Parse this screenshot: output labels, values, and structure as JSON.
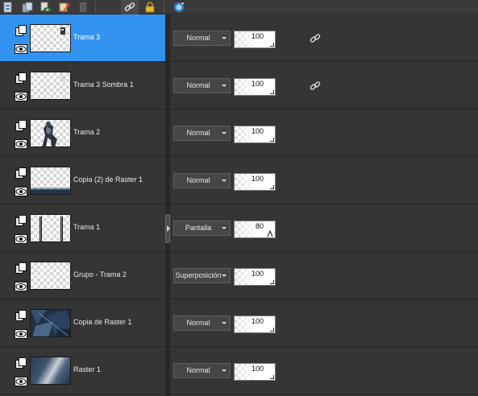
{
  "toolbar": {
    "icons": [
      "new-layer-icon",
      "new-group-icon",
      "visibility-toggle-icon",
      "delete-layer-icon",
      "mask-icon",
      "link-icon",
      "lock-icon",
      "refresh-icon"
    ]
  },
  "colors": {
    "panel_bg": "#353535",
    "selected_row": "#3393f0",
    "divider": "#262626"
  },
  "layers": [
    {
      "name": "Trama 3",
      "blend_mode": "Normal",
      "opacity": "100",
      "linked": true,
      "selected": true
    },
    {
      "name": "Trama 3 Sombra 1",
      "blend_mode": "Normal",
      "opacity": "100",
      "linked": true,
      "selected": false
    },
    {
      "name": "Trama 2",
      "blend_mode": "Normal",
      "opacity": "100",
      "linked": false,
      "selected": false
    },
    {
      "name": "Copia (2) de Raster 1",
      "blend_mode": "Normal",
      "opacity": "100",
      "linked": false,
      "selected": false
    },
    {
      "name": "Trama 1",
      "blend_mode": "Pantalla",
      "opacity": "80",
      "linked": false,
      "selected": false
    },
    {
      "name": "Grupo - Trama 2",
      "blend_mode": "Superposición",
      "opacity": "100",
      "linked": false,
      "selected": false
    },
    {
      "name": "Copia de Raster 1",
      "blend_mode": "Normal",
      "opacity": "100",
      "linked": false,
      "selected": false
    },
    {
      "name": "Raster 1",
      "blend_mode": "Normal",
      "opacity": "100",
      "linked": false,
      "selected": false
    }
  ]
}
